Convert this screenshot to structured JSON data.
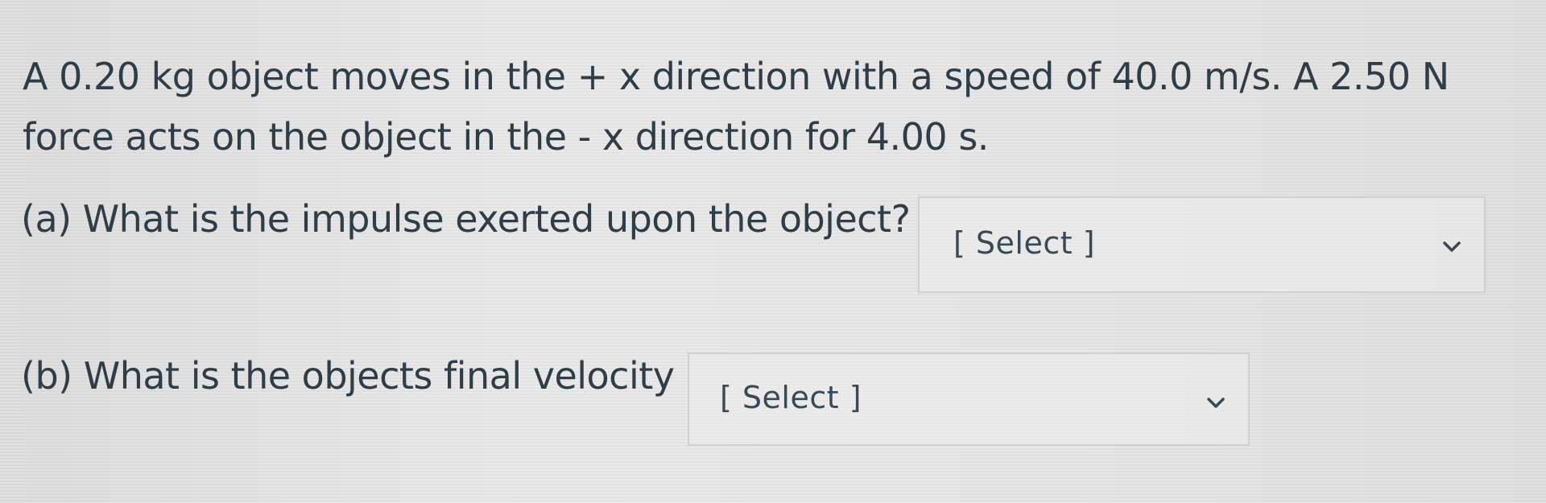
{
  "question": {
    "line1": "A 0.20 kg object moves in the + x direction with a speed of 40.0 m/s.  A  2.50 N",
    "line2": "force  acts on the object in the - x direction for  4.00 s."
  },
  "parts": [
    {
      "label": "(a) What is the impulse exerted upon the object?",
      "select_value": "[ Select ]",
      "icon": "chevron-down-icon"
    },
    {
      "label": "(b) What is the objects final velocity",
      "select_value": "[ Select ]",
      "icon": "chevron-down-icon"
    }
  ],
  "colors": {
    "text": "#2f3d47",
    "background": "#e6e6e6",
    "select_border": "#d0d0d0"
  }
}
